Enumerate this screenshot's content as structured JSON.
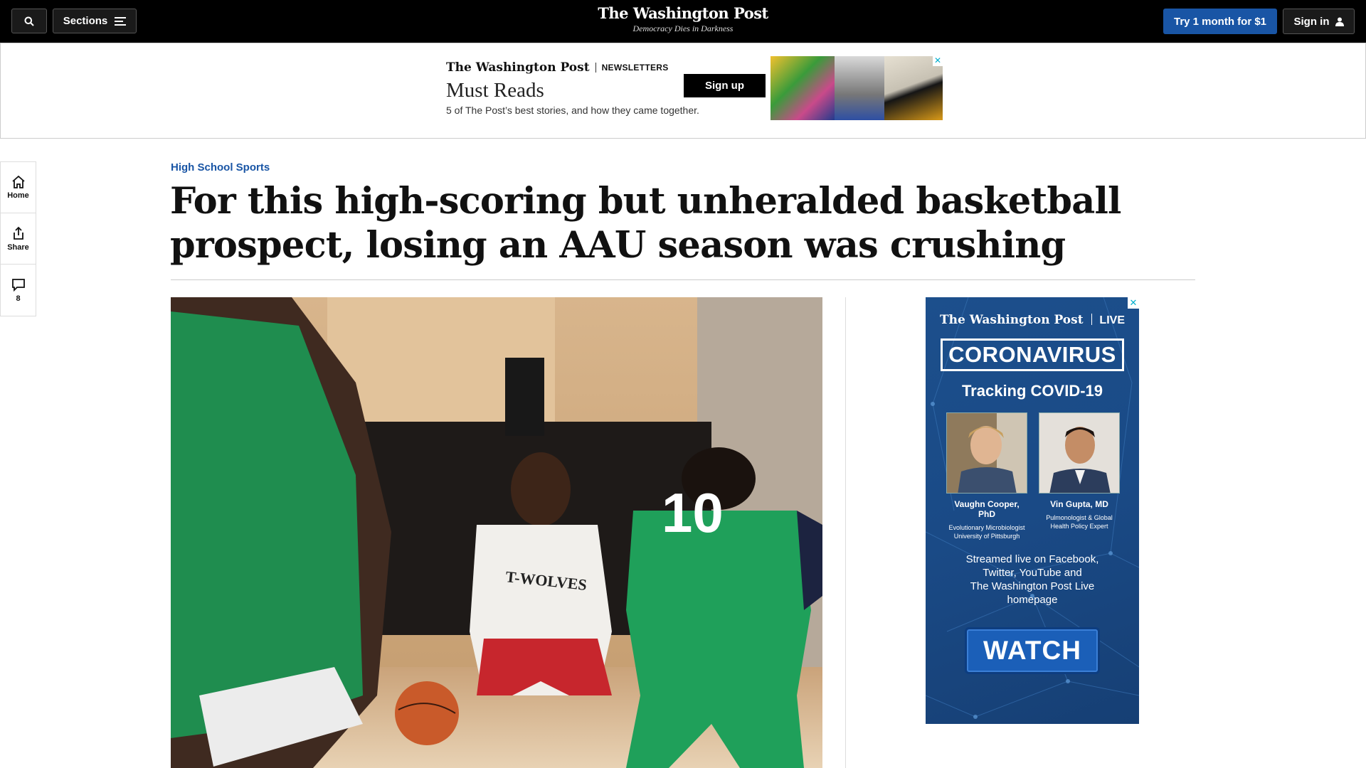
{
  "header": {
    "sections_label": "Sections",
    "logo": "The Washington Post",
    "tagline": "Democracy Dies in Darkness",
    "try_label": "Try 1 month for $1",
    "signin_label": "Sign in"
  },
  "top_ad": {
    "brand": "The Washington Post",
    "section": "NEWSLETTERS",
    "title": "Must Reads",
    "subtitle": "5 of The Post’s best stories, and how they came together.",
    "cta": "Sign up",
    "close": "✕"
  },
  "rail": {
    "home_label": "Home",
    "share_label": "Share",
    "comments_count": "8"
  },
  "article": {
    "kicker": "High School Sports",
    "headline": "For this high-scoring but unheralded basketball prospect, losing an AAU season was crushing"
  },
  "side_ad": {
    "brand": "The Washington Post",
    "brand_suffix": "LIVE",
    "banner": "CORONAVIRUS",
    "headline": "Tracking COVID-19",
    "speakers": [
      {
        "name": "Vaughn Cooper, PhD",
        "role_line1": "Evolutionary Microbiologist",
        "role_line2": "University of Pittsburgh"
      },
      {
        "name": "Vin Gupta, MD",
        "role_line1": "Pulmonologist & Global",
        "role_line2": "Health Policy Expert"
      }
    ],
    "stream_line1": "Streamed live on Facebook,",
    "stream_line2": "Twitter, YouTube and",
    "stream_line3": "The Washington Post Live",
    "stream_line4": "homepage",
    "cta": "WATCH",
    "close": "✕"
  },
  "colors": {
    "accent": "#1955a5",
    "header_bg": "#000000",
    "ad_blue": "#1c4f8c"
  }
}
